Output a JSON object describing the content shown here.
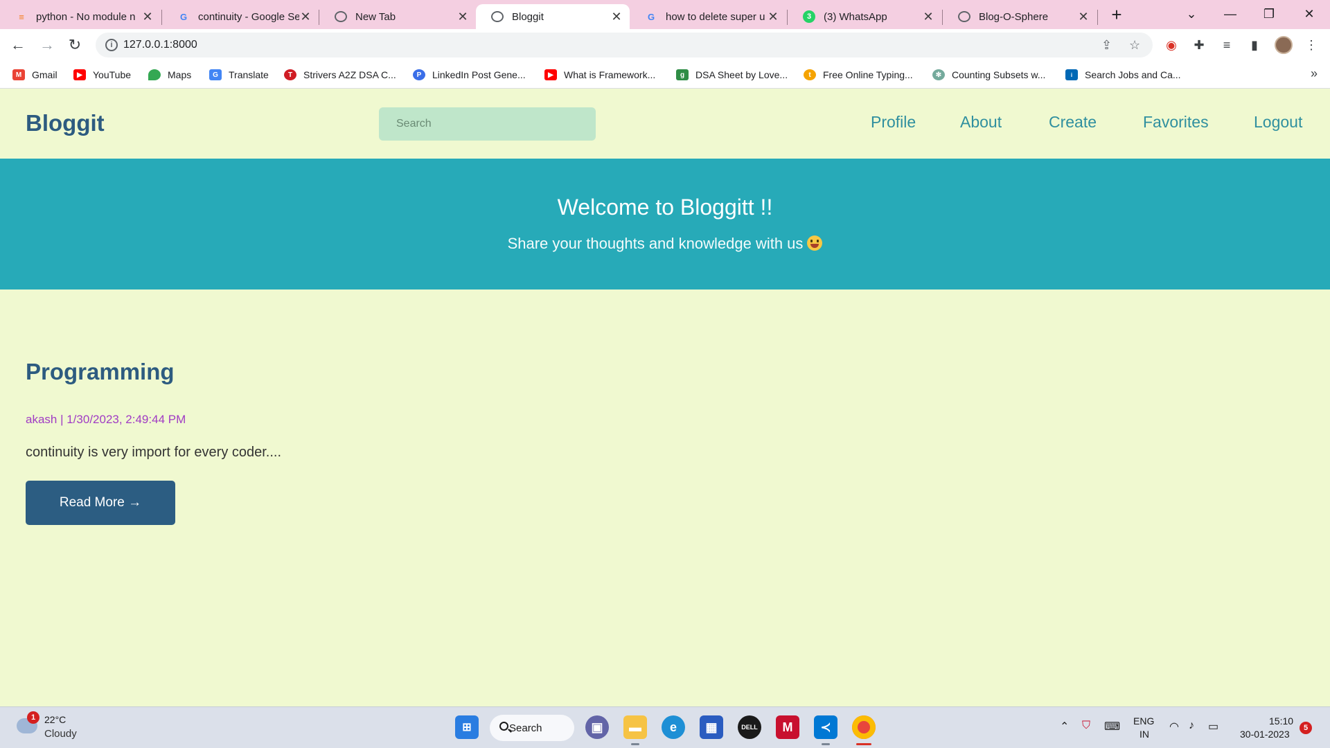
{
  "browser": {
    "tabs": [
      {
        "title": "python - No module n",
        "icon": "stackoverflow-icon"
      },
      {
        "title": "continuity - Google Se",
        "icon": "google-icon"
      },
      {
        "title": "New Tab",
        "icon": "chrome-icon"
      },
      {
        "title": "Bloggit",
        "icon": "globe-icon",
        "active": true
      },
      {
        "title": "how to delete super u",
        "icon": "google-icon"
      },
      {
        "title": "(3) WhatsApp",
        "icon": "whatsapp-icon",
        "badge": "3"
      },
      {
        "title": "Blog-O-Sphere",
        "icon": "globe-icon"
      }
    ],
    "url": "127.0.0.1:8000",
    "bookmarks": [
      {
        "label": "Gmail",
        "icon": "gmail-icon",
        "color": "#ea4335"
      },
      {
        "label": "YouTube",
        "icon": "youtube-icon",
        "color": "#ff0000"
      },
      {
        "label": "Maps",
        "icon": "maps-icon",
        "color": "#34a853"
      },
      {
        "label": "Translate",
        "icon": "translate-icon",
        "color": "#4285f4"
      },
      {
        "label": "Strivers A2Z DSA C...",
        "icon": "tuf-icon",
        "color": "#d01c24"
      },
      {
        "label": "LinkedIn Post Gene...",
        "icon": "linkedin-gen-icon",
        "color": "#3a6ee8"
      },
      {
        "label": "What is Framework...",
        "icon": "youtube-icon",
        "color": "#ff0000"
      },
      {
        "label": "DSA Sheet by Love...",
        "icon": "gfg-icon",
        "color": "#2f8d46"
      },
      {
        "label": "Free Online Typing...",
        "icon": "typing-icon",
        "color": "#f5a300"
      },
      {
        "label": "Counting Subsets w...",
        "icon": "openai-icon",
        "color": "#74aa9c"
      },
      {
        "label": "Search Jobs and Ca...",
        "icon": "intel-icon",
        "color": "#0068b5"
      }
    ]
  },
  "site": {
    "brand": "Bloggit",
    "search_placeholder": "Search",
    "nav": [
      "Profile",
      "About",
      "Create",
      "Favorites",
      "Logout"
    ],
    "hero_title": "Welcome to Bloggitt !!",
    "hero_subtitle": "Share your thoughts and knowledge with us",
    "post": {
      "title": "Programming",
      "meta": "akash | 1/30/2023, 2:49:44 PM",
      "excerpt": "continuity is very import for every coder....",
      "button": "Read More →"
    }
  },
  "taskbar": {
    "temperature": "22°C",
    "condition": "Cloudy",
    "weather_badge": "1",
    "search": "Search",
    "lang1": "ENG",
    "lang2": "IN",
    "time": "15:10",
    "date": "30-01-2023",
    "notifications": "5"
  },
  "colors": {
    "page_bg": "#f0f9d0",
    "hero_bg": "#27aab8",
    "brand": "#2d5b80",
    "nav_link": "#2f8f9f",
    "meta": "#a03bc4",
    "button": "#2c5d82",
    "tab_strip": "#f4cfe1"
  }
}
